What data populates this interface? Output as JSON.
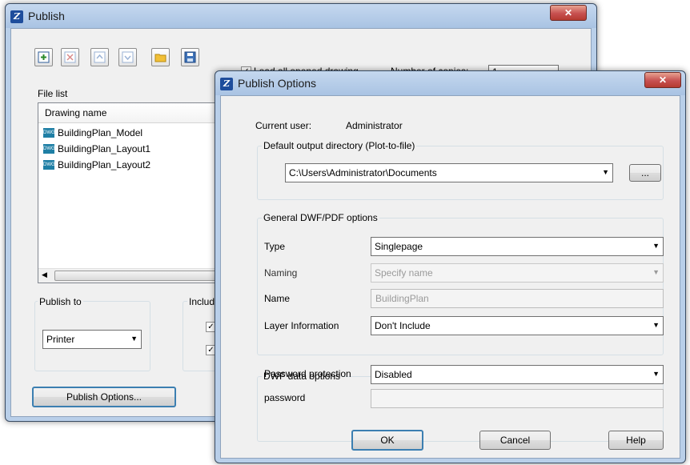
{
  "publish": {
    "title": "Publish",
    "load_all_label": "Load all opened drawing",
    "copies_label": "Number of copies:",
    "copies_value": "1",
    "file_list_label": "File list",
    "column_header": "Drawing name",
    "file_icon_label": "DWG",
    "files": [
      "BuildingPlan_Model",
      "BuildingPlan_Layout1",
      "BuildingPlan_Layout2"
    ],
    "publish_to_label": "Publish to",
    "publish_to_value": "Printer",
    "include_label": "Includ",
    "publish_options_button": "Publish Options..."
  },
  "options": {
    "title": "Publish Options",
    "current_user_label": "Current user:",
    "current_user_value": "Administrator",
    "output_dir_label": "Default output directory (Plot-to-file)",
    "output_dir_value": "C:\\Users\\Administrator\\Documents",
    "browse_label": "...",
    "general_label": "General DWF/PDF options",
    "type_label": "Type",
    "type_value": "Singlepage",
    "naming_label": "Naming",
    "naming_value": "Specify name",
    "name_label": "Name",
    "name_value": "BuildingPlan",
    "layer_label": "Layer Information",
    "layer_value": "Don't Include",
    "dwf_label": "DWF data options",
    "password_protection_label": "Password protection",
    "password_protection_value": "Disabled",
    "password_label": "password",
    "ok": "OK",
    "cancel": "Cancel",
    "help": "Help"
  },
  "icons": {
    "app": "app-logo-icon",
    "toolbar": [
      "add-sheet-icon",
      "remove-sheet-icon",
      "move-up-icon",
      "move-down-icon",
      "open-folder-icon",
      "save-list-icon"
    ],
    "file": "dwg-file-icon"
  },
  "colors": {
    "title_bar": "#b9cfe9",
    "close_button": "#c75050",
    "dialog_bg": "#f0f0f0"
  }
}
